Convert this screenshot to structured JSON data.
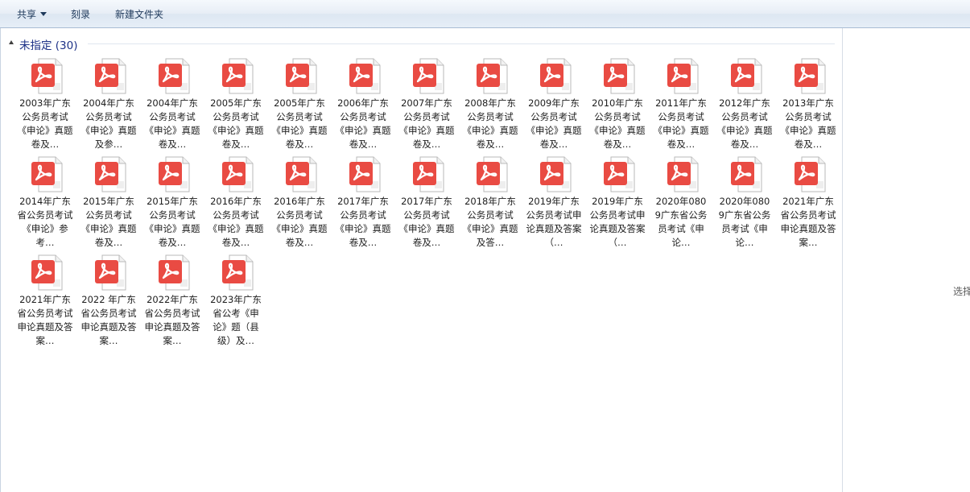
{
  "toolbar": {
    "share_label": "共享",
    "burn_label": "刻录",
    "new_folder_label": "新建文件夹"
  },
  "group": {
    "title": "未指定 (30)"
  },
  "preview": {
    "text": "选择"
  },
  "icons": {
    "file_icon": "pdf-document-icon",
    "accent": "#e94b43"
  },
  "files": [
    {
      "label": "2003年广东公务员考试《申论》真题卷及…"
    },
    {
      "label": "2004年广东公务员考试《申论》真题及参…"
    },
    {
      "label": "2004年广东公务员考试《申论》真题卷及…"
    },
    {
      "label": "2005年广东公务员考试《申论》真题卷及…"
    },
    {
      "label": "2005年广东公务员考试《申论》真题卷及…"
    },
    {
      "label": "2006年广东公务员考试《申论》真题卷及…"
    },
    {
      "label": "2007年广东公务员考试《申论》真题卷及…"
    },
    {
      "label": "2008年广东公务员考试《申论》真题卷及…"
    },
    {
      "label": "2009年广东公务员考试《申论》真题卷及…"
    },
    {
      "label": "2010年广东公务员考试《申论》真题卷及…"
    },
    {
      "label": "2011年广东公务员考试《申论》真题卷及…"
    },
    {
      "label": "2012年广东公务员考试《申论》真题卷及…"
    },
    {
      "label": "2013年广东公务员考试《申论》真题卷及…"
    },
    {
      "label": "2014年广东省公务员考试《申论》参考…"
    },
    {
      "label": "2015年广东公务员考试《申论》真题卷及…"
    },
    {
      "label": "2015年广东公务员考试《申论》真题卷及…"
    },
    {
      "label": "2016年广东公务员考试《申论》真题卷及…"
    },
    {
      "label": "2016年广东公务员考试《申论》真题卷及…"
    },
    {
      "label": "2017年广东公务员考试《申论》真题卷及…"
    },
    {
      "label": "2017年广东公务员考试《申论》真题卷及…"
    },
    {
      "label": "2018年广东公务员考试《申论》真题及答…"
    },
    {
      "label": "2019年广东公务员考试申论真题及答案（…"
    },
    {
      "label": "2019年广东公务员考试申论真题及答案（…"
    },
    {
      "label": "2020年0809广东省公务员考试《申论…"
    },
    {
      "label": "2020年0809广东省公务员考试《申论…"
    },
    {
      "label": "2021年广东省公务员考试申论真题及答案…"
    },
    {
      "label": "2021年广东省公务员考试申论真题及答案…"
    },
    {
      "label": "2022 年广东省公务员考试申论真题及答案…"
    },
    {
      "label": "2022年广东省公务员考试申论真题及答案…"
    },
    {
      "label": "2023年广东省公考《申论》题（县级）及…"
    }
  ]
}
